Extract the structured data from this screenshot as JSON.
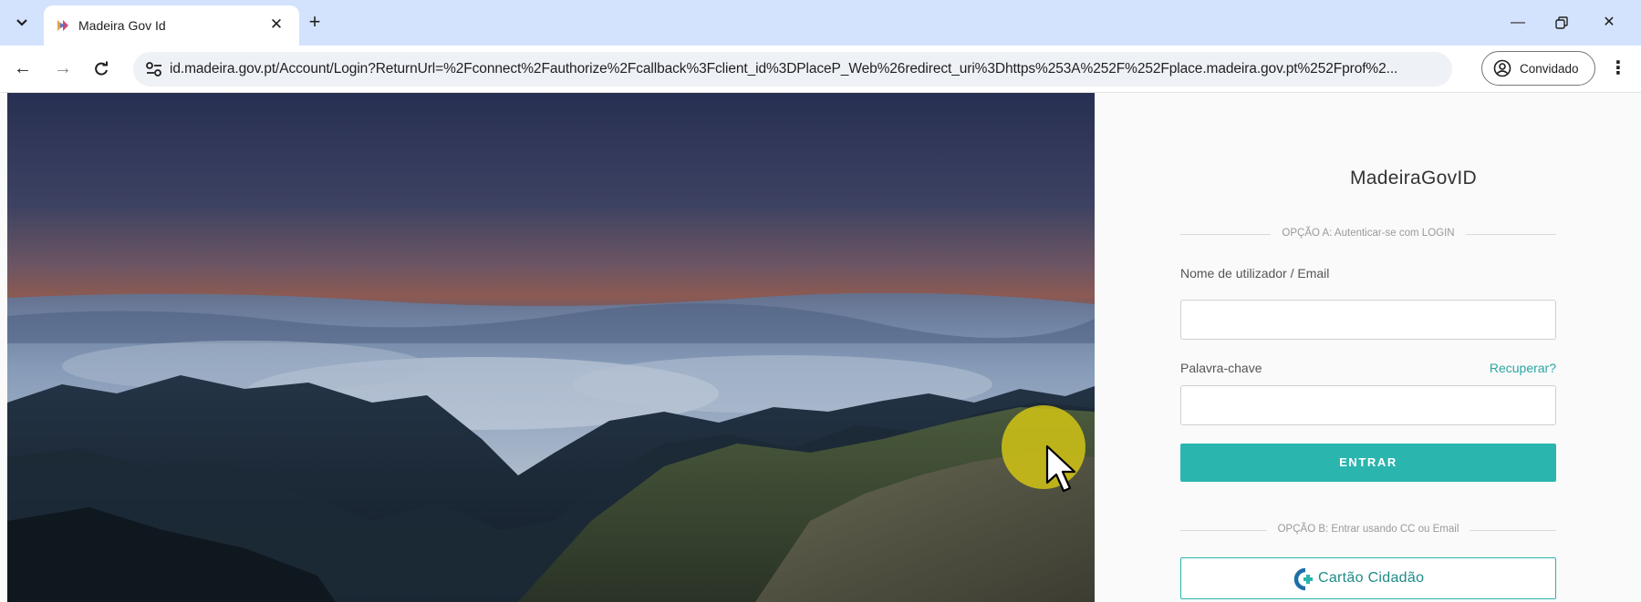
{
  "browser": {
    "tab": {
      "title": "Madeira Gov Id",
      "close_glyph": "✕",
      "favicon": "madeira-gov-favicon"
    },
    "new_tab_glyph": "+",
    "tab_search_glyph": "⌄",
    "window": {
      "minimize_glyph": "—",
      "restore_glyph": "❐",
      "close_glyph": "✕"
    },
    "nav": {
      "back_glyph": "←",
      "forward_glyph": "→",
      "reload_glyph": "C"
    },
    "url": "id.madeira.gov.pt/Account/Login?ReturnUrl=%2Fconnect%2Fauthorize%2Fcallback%3Fclient_id%3DPlaceP_Web%26redirect_uri%3Dhttps%253A%252F%252Fplace.madeira.gov.pt%252Fprof%2...",
    "profile_label": "Convidado",
    "menu_glyph": "⋮"
  },
  "login": {
    "title": "MadeiraGovID",
    "option_a": "OPÇÃO A: Autenticar-se com LOGIN",
    "username_label": "Nome de utilizador / Email",
    "password_label": "Palavra-chave",
    "recover_link": "Recuperar?",
    "submit_label": "ENTRAR",
    "option_b": "OPÇÃO B: Entrar usando CC ou Email",
    "cc_button_label": "Cartão Cidadão"
  },
  "colors": {
    "accent": "#2ab5ae",
    "tabstrip": "#d3e3fd",
    "cursor_highlight": "#d7c814"
  }
}
